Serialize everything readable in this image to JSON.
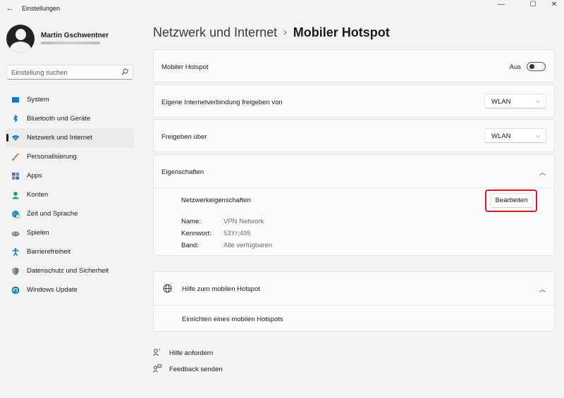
{
  "window": {
    "title": "Einstellungen",
    "back_icon": "←",
    "minimize_icon": "—",
    "maximize_icon": "☐",
    "close_icon": "✕"
  },
  "user": {
    "name": "Martin Gschwentner"
  },
  "search": {
    "placeholder": "Einstellung suchen"
  },
  "sidebar": {
    "items": [
      {
        "label": "System",
        "icon": "system-icon",
        "color": "#0078d4"
      },
      {
        "label": "Bluetooth und Geräte",
        "icon": "bluetooth-icon",
        "color": "#0078d4"
      },
      {
        "label": "Netzwerk und Internet",
        "icon": "network-icon",
        "color": "#0078d4",
        "active": true
      },
      {
        "label": "Personalisierung",
        "icon": "brush-icon",
        "color": "#e07a2e"
      },
      {
        "label": "Apps",
        "icon": "apps-icon",
        "color": "#4a6fa5"
      },
      {
        "label": "Konten",
        "icon": "account-icon",
        "color": "#1a9f7a"
      },
      {
        "label": "Zeit und Sprache",
        "icon": "globe-clock-icon",
        "color": "#1f8fd6"
      },
      {
        "label": "Spielen",
        "icon": "gamepad-icon",
        "color": "#7a8a9a"
      },
      {
        "label": "Barrierefreiheit",
        "icon": "accessibility-icon",
        "color": "#1565c0"
      },
      {
        "label": "Datenschutz und Sicherheit",
        "icon": "shield-icon",
        "color": "#6b7785"
      },
      {
        "label": "Windows Update",
        "icon": "update-icon",
        "color": "#0a7fc4"
      }
    ]
  },
  "breadcrumb": {
    "parent": "Netzwerk und Internet",
    "separator": "›",
    "current": "Mobiler Hotspot"
  },
  "hotspot": {
    "label": "Mobiler Hotspot",
    "toggle_state": "Aus"
  },
  "share_from": {
    "label": "Eigene Internetverbindung freigeben von",
    "value": "WLAN"
  },
  "share_over": {
    "label": "Freigeben über",
    "value": "WLAN"
  },
  "properties": {
    "label": "Eigenschaften",
    "network_props_label": "Netzwerkeigenschaften",
    "edit_button": "Bearbeiten",
    "name_label": "Name:",
    "name_value": "VPN Network",
    "password_label": "Kennwort:",
    "password_value": "53Yr;495",
    "band_label": "Band:",
    "band_value": "Alle verfügbaren"
  },
  "help": {
    "label": "Hilfe zum mobilen Hotspot",
    "link": "Einrichten eines mobilen Hotspots"
  },
  "footer": {
    "get_help": "Hilfe anfordern",
    "feedback": "Feedback senden"
  },
  "colors": {
    "accent": "#0078d4",
    "highlight_border": "#d11c2b"
  }
}
